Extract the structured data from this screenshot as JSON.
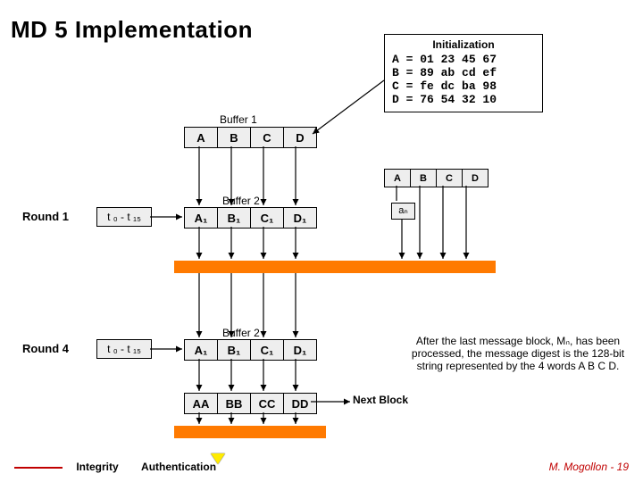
{
  "title": "MD 5 Implementation",
  "init": {
    "title": "Initialization",
    "lines": [
      "A = 01 23 45 67",
      "B = 89 ab cd ef",
      "C = fe dc ba 98",
      "D = 76 54 32 10"
    ]
  },
  "buffer1": {
    "label": "Buffer 1",
    "cells": [
      "A",
      "B",
      "C",
      "D"
    ]
  },
  "buffer_small": {
    "cells": [
      "A",
      "B",
      "C",
      "D"
    ]
  },
  "buffer2a": {
    "label": "Buffer 2",
    "cells": [
      "A₁",
      "B₁",
      "C₁",
      "D₁"
    ]
  },
  "buffer2b": {
    "label": "Buffer 2",
    "cells": [
      "A₁",
      "B₁",
      "C₁",
      "D₁"
    ]
  },
  "buffer_aa": {
    "cells": [
      "AA",
      "BB",
      "CC",
      "DD"
    ]
  },
  "round1": "Round 1",
  "round4": "Round 4",
  "tvals": "t ₀ - t ₁₅",
  "an": "aₙ",
  "next_block": "Next Block",
  "after_text": "After the last message block, Mₙ, has been processed, the message digest is the 128-bit string represented by the 4 words A B C D.",
  "footer": {
    "integrity": "Integrity",
    "auth": "Authentication",
    "credit": "M. Mogollon - 19"
  }
}
